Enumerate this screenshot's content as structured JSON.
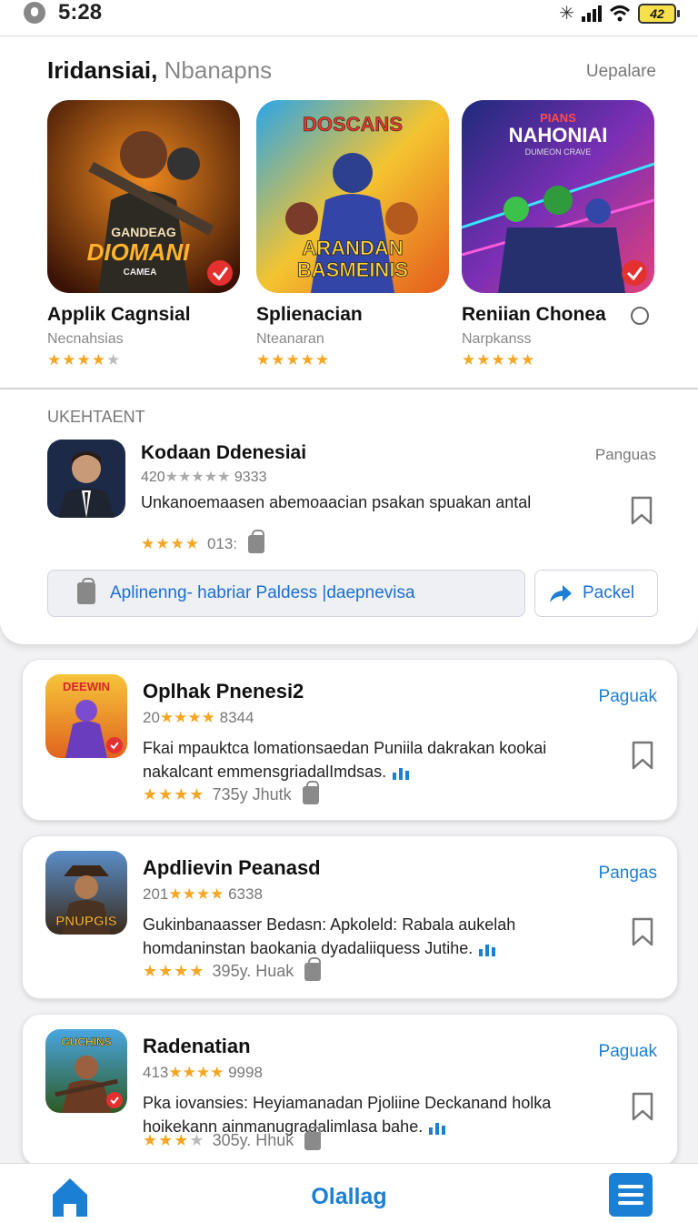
{
  "status_bar": {
    "time": "5:28",
    "battery": "42"
  },
  "featured": {
    "title_bold": "Iridansiai,",
    "title_light": "Nbanapns",
    "update_label": "Uepalare",
    "apps": [
      {
        "name": "Applik Cagnsial",
        "category": "Necnahsias",
        "stars": "★★★★",
        "stars_off": "★",
        "icon_lines": [
          "GANDEAG",
          "DIOMANI",
          "CAMEA"
        ]
      },
      {
        "name": "Splienacian",
        "category": "Nteanaran",
        "stars": "★★★★★",
        "stars_off": "",
        "icon_lines": [
          "DOSCANS",
          "ARANDAN",
          "BASMEINIS"
        ]
      },
      {
        "name": "Reniian Chonea",
        "category": "Narpkanss",
        "stars": "★★★★★",
        "stars_off": "",
        "icon_lines": [
          "PIANS",
          "NAHONIAI",
          "DUMEON CRAVE"
        ]
      }
    ]
  },
  "highlight": {
    "section": "UKEHTAENT",
    "name": "Kodaan Ddenesiai",
    "meta_prefix": "420",
    "meta_stars": "★★★★★",
    "meta_count": "9333",
    "description": "Unkanoemaasen abemoaacian psakan spuakan antal",
    "rating_stars": "★★★★",
    "rating_text": "013:",
    "side_label": "Panguas",
    "primary_button": "Aplinenng- habriar Paldess |daepnevisa",
    "share_button": "Packel"
  },
  "cards": [
    {
      "name": "Oplhak Pnenesi2",
      "meta_prefix": "20",
      "meta_stars": "★★★★",
      "meta_count": "8344",
      "desc": "Fkai mpauktca lomationsaedan Puniila dakrakan kookai nakalcant emmensgriadalImdsas.",
      "rate_stars": "★★★★",
      "rate_text": "735y  Jhutk",
      "action": "Paguak",
      "icon_lines": [
        "DEEWIN"
      ]
    },
    {
      "name": "Apdlievin Peanasd",
      "meta_prefix": "201",
      "meta_stars": "★★★★",
      "meta_count": "6338",
      "desc": "Gukinbanaasser Bedasn: Apkoleld: Rabala aukelah homdaninstan baokania dyadaliiquess Jutihe.",
      "rate_stars": "★★★★",
      "rate_text": "395y. Huak",
      "action": "Pangas",
      "icon_lines": [
        "PNUPGIS"
      ]
    },
    {
      "name": "Radenatian",
      "meta_prefix": "413",
      "meta_stars": "★★★★",
      "meta_count": "9998",
      "desc": "Pka iovansies: Heyiamanadan Pjoliine Deckanand holka hoikekann ainmanugradalimlasa bahe.",
      "rate_stars": "★★★",
      "rate_stars_off": "★",
      "rate_text": "305y. Hhuk",
      "action": "Paguak",
      "icon_lines": [
        "GUCHINS"
      ]
    }
  ],
  "bottom_nav": {
    "label": "Olallag"
  },
  "colors": {
    "accent": "#1b7fd4",
    "star": "#f5a623"
  }
}
